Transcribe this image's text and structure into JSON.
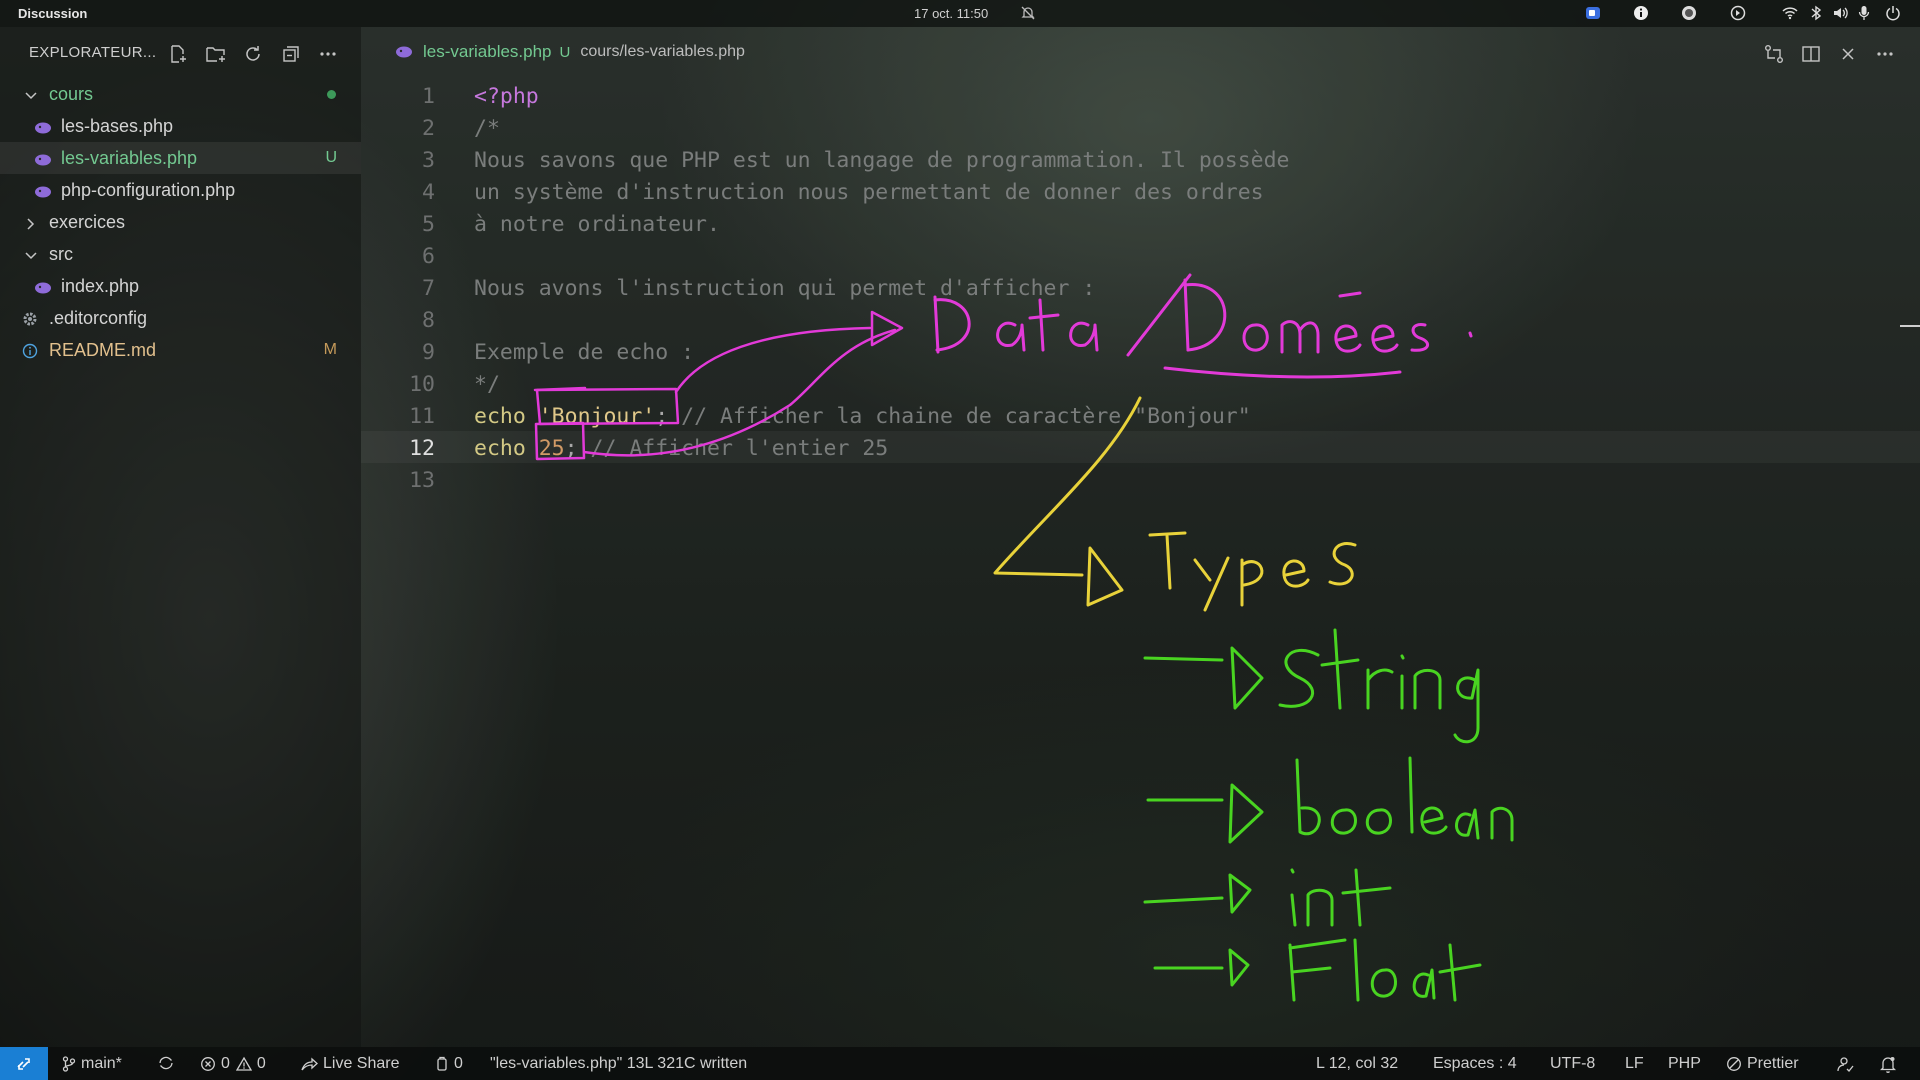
{
  "topbar": {
    "app_name": "Discussion",
    "clock": "17 oct.  11:50"
  },
  "sidebar": {
    "title": "EXPLORATEUR...",
    "items": [
      {
        "label": "cours",
        "type": "folder-open"
      },
      {
        "label": "les-bases.php",
        "type": "php"
      },
      {
        "label": "les-variables.php",
        "type": "php",
        "badge": "U"
      },
      {
        "label": "php-configuration.php",
        "type": "php"
      },
      {
        "label": "exercices",
        "type": "folder-closed"
      },
      {
        "label": "src",
        "type": "folder-open"
      },
      {
        "label": "index.php",
        "type": "php"
      },
      {
        "label": ".editorconfig",
        "type": "gear"
      },
      {
        "label": "README.md",
        "type": "info",
        "badge": "M"
      }
    ]
  },
  "editor": {
    "tab": {
      "name": "les-variables.php",
      "status": "U",
      "path": "cours/les-variables.php"
    },
    "lines": [
      {
        "n": "1",
        "text": "<?php"
      },
      {
        "n": "2",
        "text": "/*"
      },
      {
        "n": "3",
        "text": "Nous savons que PHP est un langage de programmation. Il possède"
      },
      {
        "n": "4",
        "text": "un système d'instruction nous permettant de donner des ordres"
      },
      {
        "n": "5",
        "text": "à notre ordinateur."
      },
      {
        "n": "6",
        "text": ""
      },
      {
        "n": "7",
        "text": "Nous avons l'instruction qui permet d'afficher :"
      },
      {
        "n": "8",
        "text": ""
      },
      {
        "n": "9",
        "text": "Exemple de echo :"
      },
      {
        "n": "10",
        "text": "*/"
      },
      {
        "n": "11",
        "kw": "echo",
        "val": "'Bonjour'",
        "punc": ";",
        "comment": "// Afficher la chaine de caractère \"Bonjour\""
      },
      {
        "n": "12",
        "kw": "echo",
        "val": "25",
        "punc": ";",
        "comment": "// Afficher l'entier 25"
      },
      {
        "n": "13",
        "text": ""
      }
    ],
    "current_line": "12"
  },
  "annotations": {
    "heading": "Data / Données.",
    "types_label": "Types",
    "type_list": [
      "String",
      "boolean",
      "int",
      "Float"
    ],
    "colors": {
      "magenta": "#e23ad8",
      "yellow": "#e8d23a",
      "green": "#49d421"
    }
  },
  "statusbar": {
    "branch": "main*",
    "errors": "0",
    "warnings": "0",
    "live_share": "Live Share",
    "ports": "0",
    "message": "\"les-variables.php\" 13L 321C written",
    "position": "L 12, col 32",
    "spaces": "Espaces : 4",
    "encoding": "UTF-8",
    "eol": "LF",
    "language": "PHP",
    "formatter": "Prettier"
  }
}
